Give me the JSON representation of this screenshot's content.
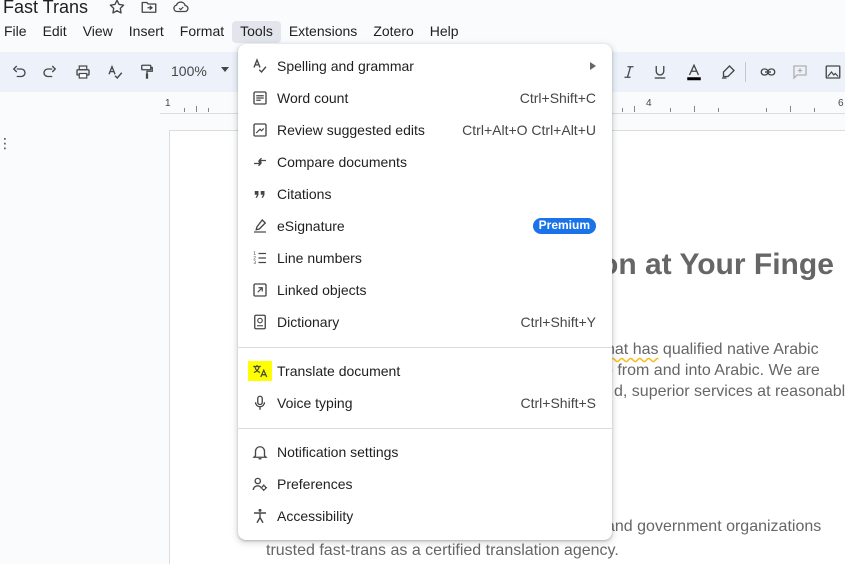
{
  "document": {
    "title": "Fast Trans",
    "heading_fragment": "on at Your Finge",
    "para1": [
      {
        "plain": "",
        "squiggle": "hat has",
        "rest": " qualified native Arabic"
      },
      {
        "plain": "",
        "squiggle": "",
        "rest": "o from and into Arabic. We are"
      },
      {
        "plain": "",
        "squiggle": "",
        "rest": "d, superior services at reasonable"
      }
    ],
    "para2": [
      "and government organizations",
      "trusted fast-trans as a certified translation agency."
    ]
  },
  "menubar": {
    "items": [
      "File",
      "Edit",
      "View",
      "Insert",
      "Format",
      "Tools",
      "Extensions",
      "Zotero",
      "Help"
    ],
    "active": "Tools"
  },
  "toolbar": {
    "zoom": "100%",
    "ruler_numbers": [
      "1",
      "4",
      "6"
    ]
  },
  "tools_menu": {
    "items": [
      {
        "label": "Spelling and grammar",
        "icon": "spellcheck-icon",
        "submenu": true
      },
      {
        "label": "Word count",
        "icon": "word-count-icon",
        "shortcut": "Ctrl+Shift+C"
      },
      {
        "label": "Review suggested edits",
        "icon": "review-edits-icon",
        "shortcut": "Ctrl+Alt+O Ctrl+Alt+U"
      },
      {
        "label": "Compare documents",
        "icon": "compare-icon"
      },
      {
        "label": "Citations",
        "icon": "quote-icon"
      },
      {
        "label": "eSignature",
        "icon": "signature-icon",
        "badge": "Premium"
      },
      {
        "label": "Line numbers",
        "icon": "line-numbers-icon"
      },
      {
        "label": "Linked objects",
        "icon": "linked-objects-icon"
      },
      {
        "label": "Dictionary",
        "icon": "dictionary-icon",
        "shortcut": "Ctrl+Shift+Y"
      },
      {
        "label": "Translate document",
        "icon": "translate-icon",
        "highlighted": true
      },
      {
        "label": "Voice typing",
        "icon": "microphone-icon",
        "shortcut": "Ctrl+Shift+S"
      },
      {
        "label": "Notification settings",
        "icon": "bell-icon"
      },
      {
        "label": "Preferences",
        "icon": "preferences-icon"
      },
      {
        "label": "Accessibility",
        "icon": "accessibility-icon"
      }
    ]
  },
  "colors": {
    "accent": "#1a73e8",
    "highlight": "#ffff00",
    "toolbar_bg": "#edf2fa"
  }
}
